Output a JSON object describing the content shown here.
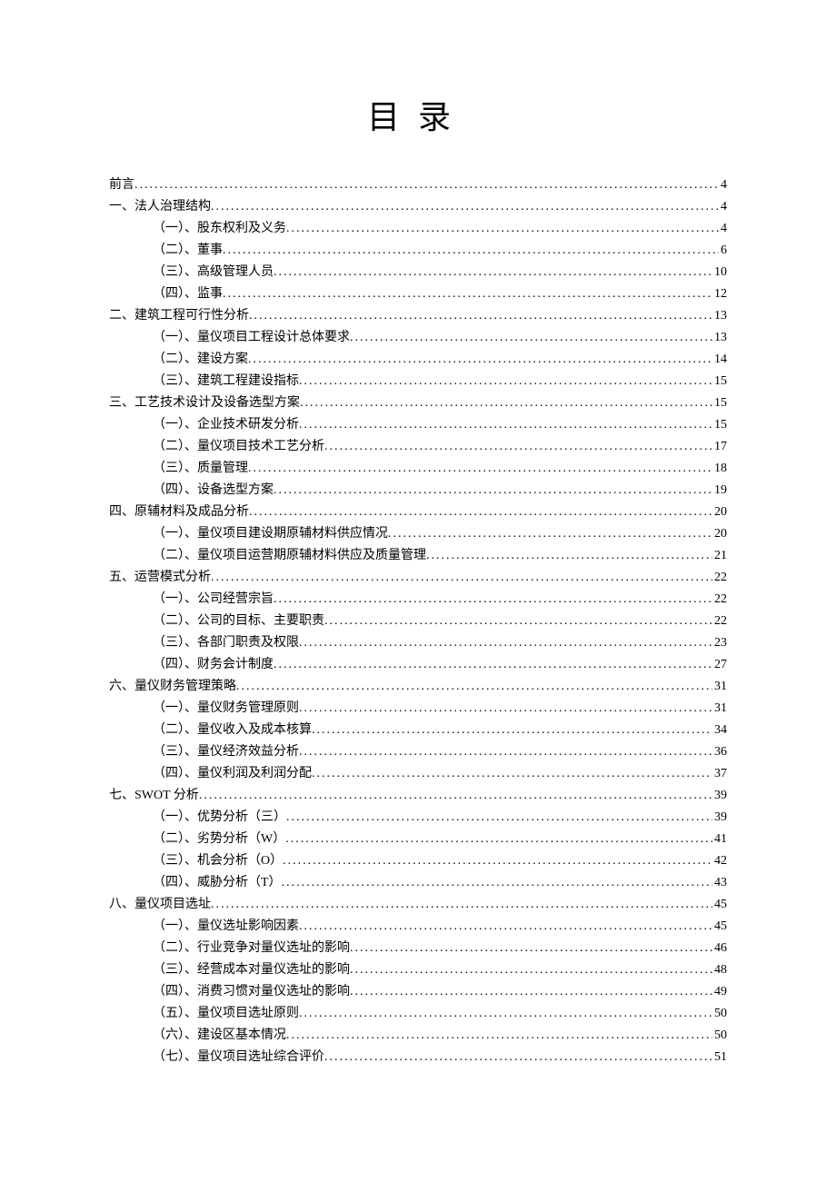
{
  "title": "目录",
  "entries": [
    {
      "level": 1,
      "label": "前言",
      "page": "4"
    },
    {
      "level": 1,
      "label": "一、法人治理结构",
      "page": "4"
    },
    {
      "level": 2,
      "label": "（一）、股东权利及义务",
      "page": "4"
    },
    {
      "level": 2,
      "label": "（二）、董事",
      "page": "6"
    },
    {
      "level": 2,
      "label": "（三）、高级管理人员",
      "page": "10"
    },
    {
      "level": 2,
      "label": "（四）、监事",
      "page": "12"
    },
    {
      "level": 1,
      "label": "二、建筑工程可行性分析",
      "page": "13"
    },
    {
      "level": 2,
      "label": "（一）、量仪项目工程设计总体要求",
      "page": "13"
    },
    {
      "level": 2,
      "label": "（二）、建设方案",
      "page": "14"
    },
    {
      "level": 2,
      "label": "（三）、建筑工程建设指标",
      "page": "15"
    },
    {
      "level": 1,
      "label": "三、工艺技术设计及设备选型方案",
      "page": "15"
    },
    {
      "level": 2,
      "label": "（一）、企业技术研发分析",
      "page": "15"
    },
    {
      "level": 2,
      "label": "（二）、量仪项目技术工艺分析",
      "page": "17"
    },
    {
      "level": 2,
      "label": "（三）、质量管理",
      "page": "18"
    },
    {
      "level": 2,
      "label": "（四）、设备选型方案",
      "page": "19"
    },
    {
      "level": 1,
      "label": "四、原辅材料及成品分析",
      "page": "20"
    },
    {
      "level": 2,
      "label": "（一）、量仪项目建设期原辅材料供应情况",
      "page": "20"
    },
    {
      "level": 2,
      "label": "（二）、量仪项目运营期原辅材料供应及质量管理",
      "page": "21"
    },
    {
      "level": 1,
      "label": "五、运营模式分析",
      "page": "22"
    },
    {
      "level": 2,
      "label": "（一）、公司经营宗旨",
      "page": "22"
    },
    {
      "level": 2,
      "label": "（二）、公司的目标、主要职责",
      "page": "22"
    },
    {
      "level": 2,
      "label": "（三）、各部门职责及权限",
      "page": "23"
    },
    {
      "level": 2,
      "label": "（四）、财务会计制度",
      "page": "27"
    },
    {
      "level": 1,
      "label": "六、量仪财务管理策略",
      "page": "31"
    },
    {
      "level": 2,
      "label": "（一）、量仪财务管理原则",
      "page": "31"
    },
    {
      "level": 2,
      "label": "（二）、量仪收入及成本核算",
      "page": "34"
    },
    {
      "level": 2,
      "label": "（三）、量仪经济效益分析",
      "page": "36"
    },
    {
      "level": 2,
      "label": "（四）、量仪利润及利润分配",
      "page": "37"
    },
    {
      "level": 1,
      "label": "七、SWOT 分析",
      "page": "39"
    },
    {
      "level": 2,
      "label": "（一）、优势分析（三）",
      "page": "39"
    },
    {
      "level": 2,
      "label": "（二）、劣势分析（W）",
      "page": "41"
    },
    {
      "level": 2,
      "label": "（三）、机会分析（O）",
      "page": "42"
    },
    {
      "level": 2,
      "label": "（四）、威胁分析（T）",
      "page": "43"
    },
    {
      "level": 1,
      "label": "八、量仪项目选址",
      "page": "45"
    },
    {
      "level": 2,
      "label": "（一）、量仪选址影响因素",
      "page": "45"
    },
    {
      "level": 2,
      "label": "（二）、行业竞争对量仪选址的影响",
      "page": "46"
    },
    {
      "level": 2,
      "label": "（三）、经营成本对量仪选址的影响",
      "page": "48"
    },
    {
      "level": 2,
      "label": "（四）、消费习惯对量仪选址的影响",
      "page": "49"
    },
    {
      "level": 2,
      "label": "（五）、量仪项目选址原则",
      "page": "50"
    },
    {
      "level": 2,
      "label": "（六）、建设区基本情况",
      "page": "50"
    },
    {
      "level": 2,
      "label": "（七）、量仪项目选址综合评价",
      "page": "51"
    }
  ]
}
